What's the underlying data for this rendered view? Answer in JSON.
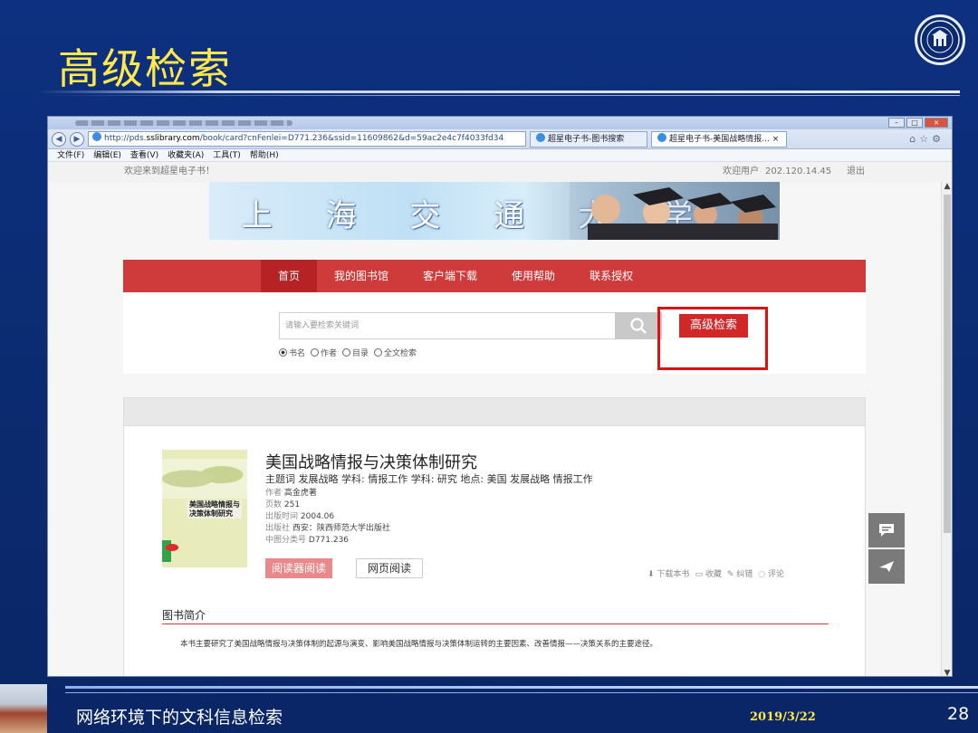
{
  "slide": {
    "title": "高级检索",
    "footer_title": "网络环境下的文科信息检索",
    "date": "2019/3/22",
    "page_number": "28"
  },
  "browser": {
    "url_prefix": "http://pds.",
    "url_host": "sslibrary.com",
    "url_rest": "/book/card?cnFenlei=D771.236&ssid=11609862&d=59ac2e4c7f4033fd34",
    "tab1": "超星电子书-图书搜索",
    "tab2": "超星电子书-美国战略情报...",
    "tab_close": "×",
    "menu": [
      "文件(F)",
      "编辑(E)",
      "查看(V)",
      "收藏夹(A)",
      "工具(T)",
      "帮助(H)"
    ]
  },
  "site": {
    "welcome": "欢迎来到超星电子书！",
    "welcome_user": "欢迎用户",
    "ip": "202.120.14.45",
    "logout": "退出",
    "banner_text": "上 海 交 通 大 学",
    "nav": [
      "首页",
      "我的图书馆",
      "客户端下载",
      "使用帮助",
      "联系授权"
    ],
    "search_placeholder": "请输入要检索关键词",
    "advanced_search": "高级检索",
    "search_types": [
      "书名",
      "作者",
      "目录",
      "全文检索"
    ]
  },
  "book": {
    "title": "美国战略情报与决策体制研究",
    "subjects": "主题词 发展战略 学科: 情报工作 学科: 研究 地点: 美国 发展战略 情报工作",
    "author_k": "作者",
    "author_v": "高金虎著",
    "pages_k": "页数",
    "pages_v": "251",
    "date_k": "出版时间",
    "date_v": "2004.06",
    "publisher_k": "出版社",
    "publisher_v": "西安：陕西师范大学出版社",
    "class_k": "中图分类号",
    "class_v": "D771.236",
    "cover_title_1": "美国战略情报与",
    "cover_title_2": "决策体制研究",
    "reader_read": "阅读器阅读",
    "web_read": "网页阅读",
    "actions": [
      "下载本书",
      "收藏",
      "纠错",
      "评论"
    ],
    "intro_heading": "图书简介",
    "intro_text": "本书主要研究了美国战略情报与决策体制的起源与演变、影响美国战略情报与决策体制运转的主要因素、改善情报——决策关系的主要途径。"
  },
  "colors": {
    "slide_bg": "#0b2a6e",
    "title_yellow": "#ffe84a",
    "nav_red": "#cf3a3b",
    "highlight_red": "#e01010"
  }
}
